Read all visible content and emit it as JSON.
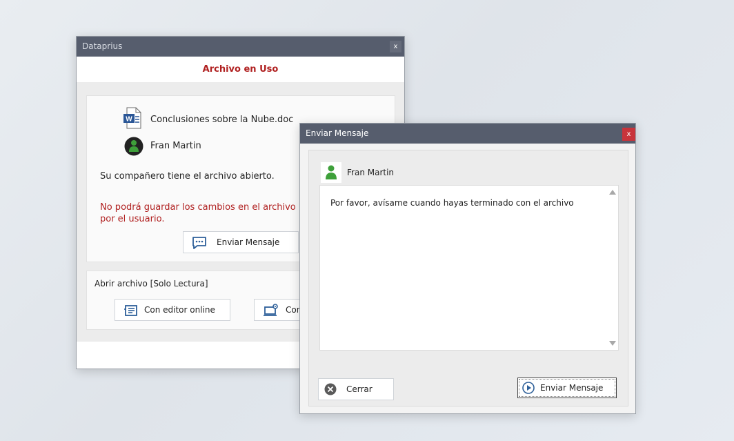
{
  "file_window": {
    "title": "Dataprius",
    "close": "x",
    "heading": "Archivo en Uso",
    "file_name": "Conclusiones sobre la Nube.doc",
    "user_name": "Fran Martin",
    "info": "Su compañero tiene el archivo abierto.",
    "warning_line1": "No podrá guardar los cambios en el archivo  hast",
    "warning_line2": "por el usuario.",
    "send_button": "Enviar Mensaje",
    "readonly_label": "Abrir archivo [Solo Lectura]",
    "online_editor_button": "Con editor online",
    "desktop_editor_button": "Con"
  },
  "message_window": {
    "title": "Enviar Mensaje",
    "close": "x",
    "recipient": "Fran Martin",
    "message": "Por favor, avísame cuando hayas terminado con el archivo",
    "close_button": "Cerrar",
    "send_button": "Enviar Mensaje"
  },
  "colors": {
    "titlebar": "#565d6d",
    "accent_red": "#b02020",
    "close_red": "#c8343b",
    "icon_blue": "#2d5f99",
    "avatar_green": "#3ea03a"
  },
  "icons": {
    "word_doc": "word-document-icon",
    "user": "user-avatar-icon",
    "chat": "chat-bubble-icon",
    "online_editor": "online-editor-icon",
    "desktop_editor": "desktop-editor-icon",
    "cancel": "close-circle-icon",
    "send": "play-circle-icon"
  }
}
